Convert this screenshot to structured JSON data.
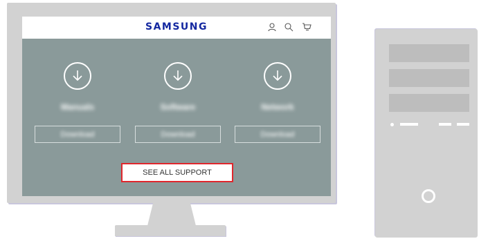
{
  "site": {
    "logo": "SAMSUNG",
    "header_icons": [
      "user-icon",
      "search-icon",
      "cart-icon"
    ]
  },
  "downloads": [
    {
      "title": "Manuals",
      "button": "Download"
    },
    {
      "title": "Software",
      "button": "Download"
    },
    {
      "title": "Network",
      "button": "Download"
    }
  ],
  "see_all": "SEE ALL SUPPORT",
  "colors": {
    "screen_bg": "#8a9a9a",
    "logo": "#1428a0",
    "highlight_border": "#e0262c",
    "device": "#d2d2d2"
  }
}
